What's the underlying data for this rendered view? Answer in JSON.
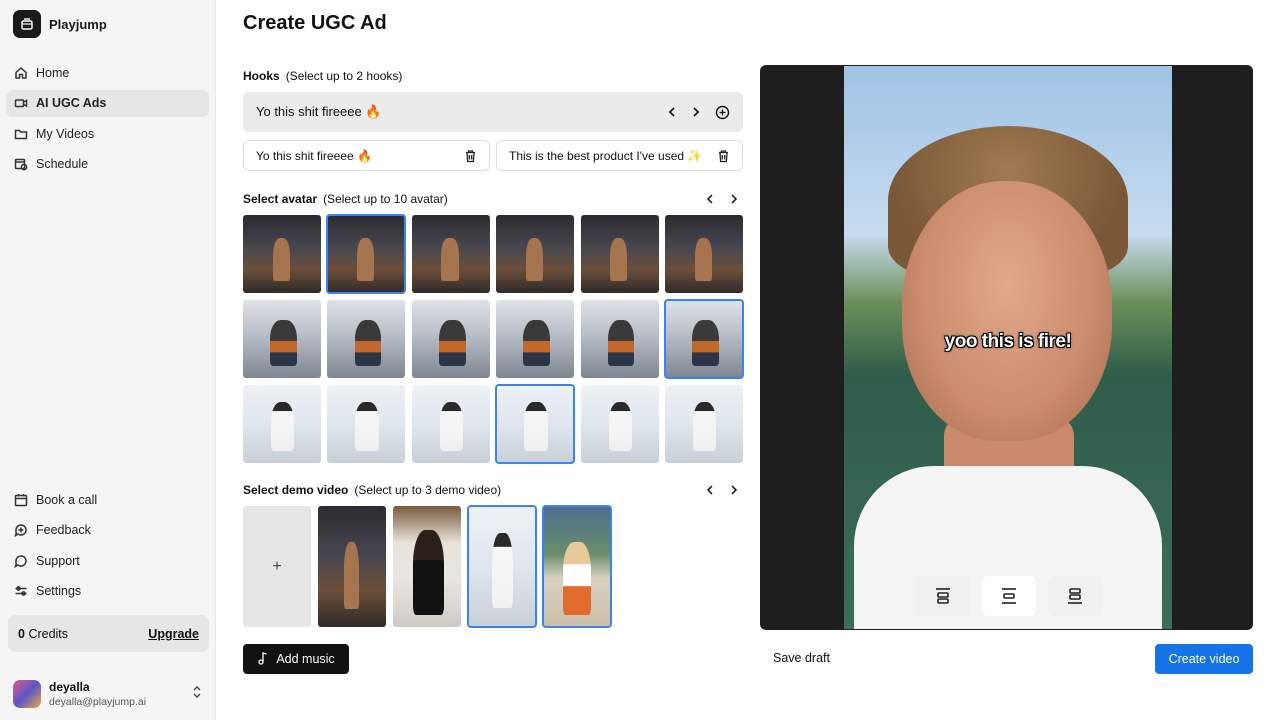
{
  "brand": {
    "name": "Playjump"
  },
  "nav": {
    "items": [
      {
        "label": "Home",
        "icon": "home-icon"
      },
      {
        "label": "AI UGC Ads",
        "icon": "video-camera-icon",
        "active": true
      },
      {
        "label": "My Videos",
        "icon": "folder-icon"
      },
      {
        "label": "Schedule",
        "icon": "calendar-clock-icon"
      }
    ],
    "bottom_items": [
      {
        "label": "Book a call",
        "icon": "calendar-icon"
      },
      {
        "label": "Feedback",
        "icon": "message-icon"
      },
      {
        "label": "Support",
        "icon": "chat-icon"
      },
      {
        "label": "Settings",
        "icon": "sliders-icon"
      }
    ]
  },
  "credits": {
    "count": "0",
    "label": "Credits",
    "upgrade_label": "Upgrade"
  },
  "user": {
    "name": "deyalla",
    "email": "deyalla@playjump.ai"
  },
  "page": {
    "title": "Create UGC Ad"
  },
  "hooks": {
    "label": "Hooks",
    "hint": "(Select up to 2 hooks)",
    "current": "Yo this shit fireeee 🔥",
    "selected": [
      {
        "text": "Yo this shit fireeee 🔥"
      },
      {
        "text": "This is the best product I've used ✨"
      }
    ]
  },
  "avatars": {
    "label": "Select avatar",
    "hint": "(Select up to 10 avatar)",
    "rows": [
      {
        "scene": "studio",
        "selected_index": 1
      },
      {
        "scene": "guitar",
        "selected_index": 5
      },
      {
        "scene": "white",
        "selected_index": 3
      }
    ]
  },
  "demo": {
    "label": "Select demo video",
    "hint": "(Select up to 3 demo video)",
    "add_symbol": "+",
    "videos": [
      {
        "scene": "studio",
        "selected": false
      },
      {
        "scene": "library",
        "selected": false
      },
      {
        "scene": "white",
        "selected": true
      },
      {
        "scene": "beach",
        "selected": true
      }
    ]
  },
  "music": {
    "label": "Add music"
  },
  "preview": {
    "caption": "yoo this is fire!",
    "caption_positions": [
      "top",
      "middle",
      "bottom"
    ],
    "active_position": "middle"
  },
  "actions": {
    "save_draft": "Save draft",
    "create": "Create video"
  },
  "colors": {
    "accent": "#1473e6",
    "selection": "#3b82f6",
    "sidebar_bg": "#f5f5f5"
  }
}
